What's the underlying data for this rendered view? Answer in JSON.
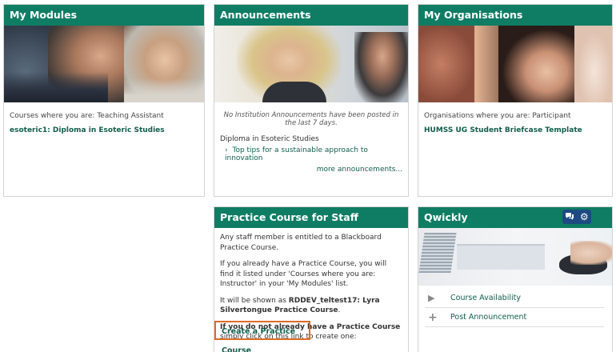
{
  "my_modules": {
    "title": "My Modules",
    "role_text": "Courses where you are: Teaching Assistant",
    "course_link": "esoteric1: Diploma in Esoteric Studies"
  },
  "announcements": {
    "title": "Announcements",
    "no_institution": "No Institution Announcements have been posted in the last 7 days.",
    "course_name": "Diploma in Esoteric Studies",
    "item": "Top tips for a sustainable approach to innovation",
    "more": "more announcements..."
  },
  "my_organisations": {
    "title": "My Organisations",
    "role_text": "Organisations where you are: Participant",
    "org_link": "HUMSS UG Student Briefcase Template"
  },
  "practice": {
    "title": "Practice Course for Staff",
    "p1": "Any staff member is entitled to a Blackboard Practice Course.",
    "p2": "If you already have a Practice Course, you will find it listed under 'Courses where you are: Instructor' in your 'My Modules' list.",
    "p3_prefix": "It will be shown as",
    "p3_bold": "RDDEV_teltest17: Lyra Silvertongue Practice Course",
    "p3_suffix": ".",
    "p4_bold": "If you do not already have a Practice Course",
    "p4_rest": "simply click on this link to create one:",
    "create_button": "Create a Practice Course"
  },
  "qwickly": {
    "title": "Qwickly",
    "items": [
      {
        "icon": "play-icon",
        "label": "Course Availability"
      },
      {
        "icon": "plus-icon",
        "label": "Post Announcement"
      }
    ]
  },
  "colors": {
    "header": "#0f7d64",
    "link": "#0f5e4b",
    "highlight": "#e06b25"
  }
}
